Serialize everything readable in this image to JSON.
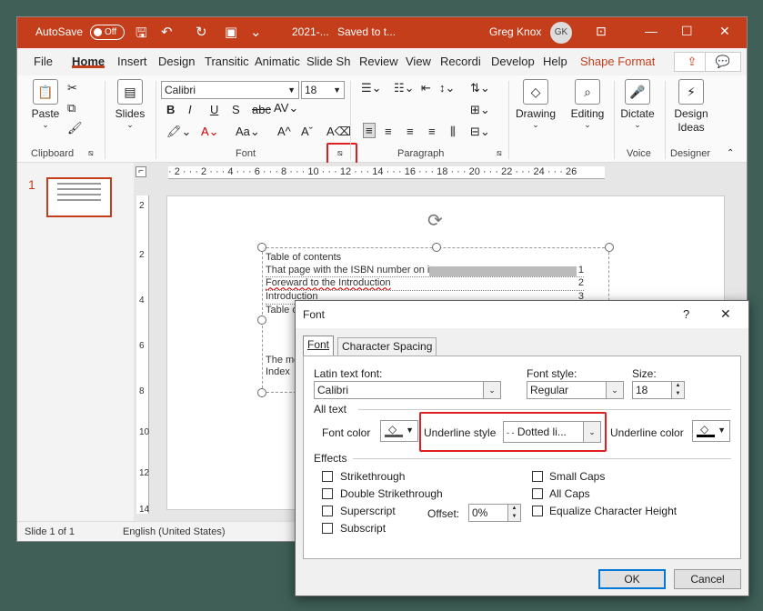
{
  "app": {
    "autosave_label": "AutoSave",
    "autosave_state": "Off",
    "doc_title": "2021-...",
    "save_status": "Saved to t...",
    "user_name": "Greg Knox",
    "user_initials": "GK"
  },
  "tabs": [
    "File",
    "Home",
    "Insert",
    "Design",
    "Transitic",
    "Animatic",
    "Slide Sh",
    "Review",
    "View",
    "Recordi",
    "Develop",
    "Help",
    "Shape Format"
  ],
  "ribbon": {
    "clipboard": {
      "label": "Clipboard",
      "paste": "Paste"
    },
    "slides": {
      "label": "Slides"
    },
    "font": {
      "label": "Font",
      "font_name": "Calibri",
      "font_size": "18"
    },
    "paragraph": {
      "label": "Paragraph"
    },
    "drawing": "Drawing",
    "editing": "Editing",
    "dictate": "Dictate",
    "voice_label": "Voice",
    "design_ideas": "Design Ideas",
    "designer_label": "Designer"
  },
  "thumbnail": {
    "number": "1"
  },
  "hruler": "· 2 · · · 2 · · · 4 · · · 6 · · · 8 · · · 10 · · · 12 · · · 14 · · · 16 · · · 18 · · · 20 · · · 22 · · · 24 · · · 26",
  "vruler": [
    "2",
    "2",
    "4",
    "6",
    "8",
    "10",
    "12",
    "14"
  ],
  "slide_text": {
    "line1": "Table of contents",
    "line2": "That page with the ISBN number on it",
    "line2_num": "1",
    "line3": "Foreward to the Introduction",
    "line3_num": "2",
    "line4": "Introduction",
    "line4_num": "3",
    "line5": "Table o",
    "line6": "The mo",
    "line7": "Index"
  },
  "status": {
    "slide": "Slide 1 of 1",
    "language": "English (United States)"
  },
  "dialog": {
    "title": "Font",
    "help": "?",
    "close": "✕",
    "tab_font": "Font",
    "tab_spacing": "Character Spacing",
    "latin_font_label": "Latin text font:",
    "latin_font_value": "Calibri",
    "font_style_label": "Font style:",
    "font_style_value": "Regular",
    "size_label": "Size:",
    "size_value": "18",
    "all_text_label": "All text",
    "font_color_label": "Font color",
    "underline_style_label": "Underline style",
    "underline_style_value": "Dotted li...",
    "underline_color_label": "Underline color",
    "effects_label": "Effects",
    "effects_left": [
      "Strikethrough",
      "Double Strikethrough",
      "Superscript",
      "Subscript"
    ],
    "effects_right": [
      "Small Caps",
      "All Caps",
      "Equalize Character Height"
    ],
    "offset_label": "Offset:",
    "offset_value": "0%",
    "ok": "OK",
    "cancel": "Cancel"
  },
  "colors": {
    "accent": "#c43e1c",
    "highlight_box": "#e02020"
  }
}
